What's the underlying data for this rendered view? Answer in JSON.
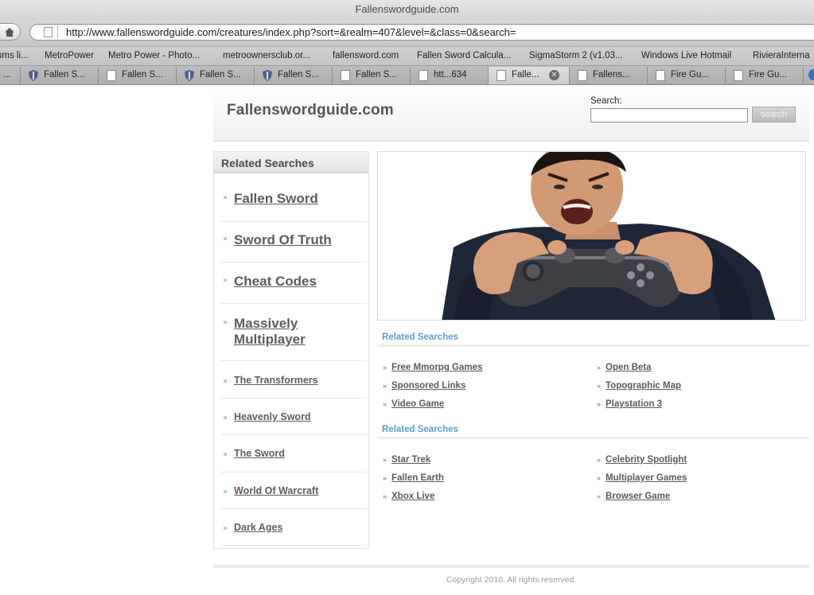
{
  "window": {
    "title": "Fallenswordguide.com"
  },
  "address_bar": {
    "url": "http://www.fallenswordguide.com/creatures/index.php?sort=&realm=407&level=&class=0&search="
  },
  "bookmarks": [
    "ums li...",
    "MetroPower",
    "Metro Power - Photo...",
    "metroownersclub.or...",
    "fallensword.com",
    "Fallen Sword Calcula...",
    "SigmaStorm 2 (v1.03...",
    "Windows Live Hotmail",
    "RivieraInterna"
  ],
  "tabs": [
    {
      "label": "...",
      "icon": "page-icon"
    },
    {
      "label": "Fallen S...",
      "icon": "shield-icon"
    },
    {
      "label": "Fallen S...",
      "icon": "page-icon"
    },
    {
      "label": "Fallen S...",
      "icon": "shield-icon"
    },
    {
      "label": "Fallen S...",
      "icon": "shield-icon"
    },
    {
      "label": "Fallen S...",
      "icon": "page-icon"
    },
    {
      "label": "htt...634",
      "icon": "page-icon"
    },
    {
      "label": "Falle...",
      "icon": "page-icon",
      "active": true
    },
    {
      "label": "Fallens...",
      "icon": "page-icon"
    },
    {
      "label": "Fire Gu...",
      "icon": "page-icon"
    },
    {
      "label": "Fire Gu...",
      "icon": "page-icon"
    }
  ],
  "header": {
    "logo": "Fallenswordguide.com",
    "search_label": "Search:",
    "search_value": "",
    "search_button": "search"
  },
  "sidebar": {
    "title": "Related Searches",
    "items": [
      {
        "label": "Fallen Sword"
      },
      {
        "label": "Sword Of Truth"
      },
      {
        "label": "Cheat Codes"
      },
      {
        "label": "Massively Multiplayer"
      },
      {
        "label": "The Transformers"
      },
      {
        "label": "Heavenly Sword"
      },
      {
        "label": "The Sword"
      },
      {
        "label": "World Of Warcraft"
      },
      {
        "label": "Dark Ages"
      }
    ]
  },
  "main": {
    "sections": [
      {
        "title": "Related Searches",
        "left": [
          "Free Mmorpg Games",
          "Sponsored Links",
          "Video Game"
        ],
        "right": [
          "Open Beta",
          "Topographic Map",
          "Playstation 3"
        ]
      },
      {
        "title": "Related Searches",
        "left": [
          "Star Trek",
          "Fallen Earth",
          "Xbox Live"
        ],
        "right": [
          "Celebrity Spotlight",
          "Multiplayer Games",
          "Browser Game"
        ]
      }
    ]
  },
  "footer": {
    "text": "Copyright 2010. All rights reserved."
  },
  "colors": {
    "link_blue": "#5b9ec8",
    "text_gray": "#5c5c5c"
  }
}
